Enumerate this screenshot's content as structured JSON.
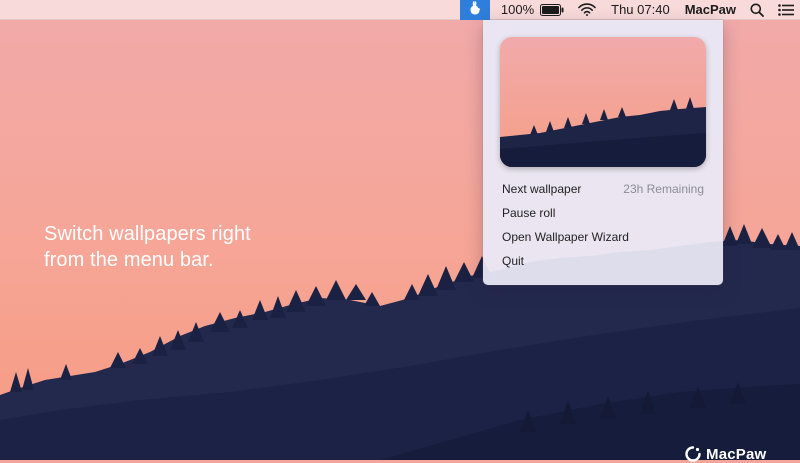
{
  "menubar": {
    "app_icon": "rabbit-icon",
    "battery_percent": "100%",
    "battery_icon": "battery-full-icon",
    "wifi_icon": "wifi-icon",
    "clock": "Thu 07:40",
    "user_name": "MacPaw",
    "search_icon": "search-icon",
    "notifications_icon": "list-icon"
  },
  "hero": {
    "line1": "Switch wallpapers right",
    "line2": "from the menu bar."
  },
  "dropdown": {
    "items": [
      {
        "label": "Next wallpaper",
        "meta": "23h Remaining"
      },
      {
        "label": "Pause roll"
      },
      {
        "label": "Open Wallpaper Wizard"
      },
      {
        "label": "Quit"
      }
    ]
  },
  "watermark": {
    "text": "MacPaw"
  },
  "colors": {
    "sky_top": "#f2a9a6",
    "sky_bottom": "#f7a284",
    "mountains": "#1a2142",
    "menubar_highlight": "#2e7fdc"
  }
}
